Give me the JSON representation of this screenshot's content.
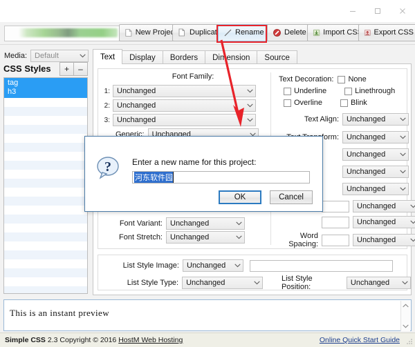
{
  "window": {
    "controls": [
      {
        "name": "minimize",
        "glyph": "—"
      },
      {
        "name": "maximize",
        "glyph": "▢"
      },
      {
        "name": "close",
        "glyph": "✕"
      }
    ]
  },
  "toolbar": {
    "project_value": "",
    "buttons": [
      {
        "label": "New Project",
        "icon": "new-project-icon"
      },
      {
        "label": "Duplicate",
        "icon": "duplicate-icon"
      },
      {
        "label": "Rename",
        "icon": "rename-icon"
      },
      {
        "label": "Delete",
        "icon": "delete-icon"
      },
      {
        "label": "Import CSS",
        "icon": "import-css-icon"
      },
      {
        "label": "Export CSS",
        "icon": "export-css-icon"
      }
    ],
    "highlight_color": "#e8232a"
  },
  "media": {
    "label": "Media:",
    "value": "Default"
  },
  "sidebar": {
    "title": "CSS Styles",
    "add_label": "+",
    "remove_label": "–",
    "selected_items": [
      "tag",
      "h3"
    ]
  },
  "tabs": [
    {
      "label": "Text",
      "active": true
    },
    {
      "label": "Display",
      "active": false
    },
    {
      "label": "Borders",
      "active": false
    },
    {
      "label": "Dimension",
      "active": false
    },
    {
      "label": "Source",
      "active": false
    }
  ],
  "font_family": {
    "title": "Font Family:",
    "rows": [
      {
        "num": "1:",
        "value": "Unchanged"
      },
      {
        "num": "2:",
        "value": "Unchanged"
      },
      {
        "num": "3:",
        "value": "Unchanged"
      }
    ],
    "generic_label": "Generic:",
    "generic_value": "Unchanged"
  },
  "text_decoration": {
    "label": "Text Decoration:",
    "options": [
      {
        "label": "None",
        "checked": false
      },
      {
        "label": "Underline",
        "checked": false
      },
      {
        "label": "Linethrough",
        "checked": false
      },
      {
        "label": "Overline",
        "checked": false
      },
      {
        "label": "Blink",
        "checked": false
      }
    ]
  },
  "right_fields": [
    {
      "label": "Text Align:",
      "value": "Unchanged"
    },
    {
      "label": "Text Transform:",
      "value": "Unchanged"
    },
    {
      "label": "",
      "value": "Unchanged"
    },
    {
      "label": "",
      "value": "Unchanged"
    },
    {
      "label": "",
      "value": "Unchanged"
    },
    {
      "label": "",
      "value": "Unchanged"
    },
    {
      "label": "",
      "value": "Unchanged"
    }
  ],
  "word_spacing": {
    "label": "Word Spacing:",
    "input_value": "",
    "unit_value": "Unchanged"
  },
  "left_fields": [
    {
      "label": "Font Variant:",
      "value": "Unchanged"
    },
    {
      "label": "Font Stretch:",
      "value": "Unchanged"
    }
  ],
  "list_style": {
    "image_label": "List Style Image:",
    "image_value": "Unchanged",
    "image_url": "",
    "type_label": "List Style Type:",
    "type_value": "Unchanged",
    "position_label": "List Style Position:",
    "position_value": "Unchanged"
  },
  "preview": {
    "text": "This is an instant preview"
  },
  "statusbar": {
    "app_name": "Simple CSS",
    "version": "2.3",
    "copyright": "Copyright © 2016",
    "vendor": "HostM Web Hosting",
    "guide_link": "Online Quick Start Guide"
  },
  "dialog": {
    "icon": "question-icon",
    "prompt": "Enter a new name for this project:",
    "input_value": "河东软件园",
    "ok_label": "OK",
    "cancel_label": "Cancel"
  }
}
